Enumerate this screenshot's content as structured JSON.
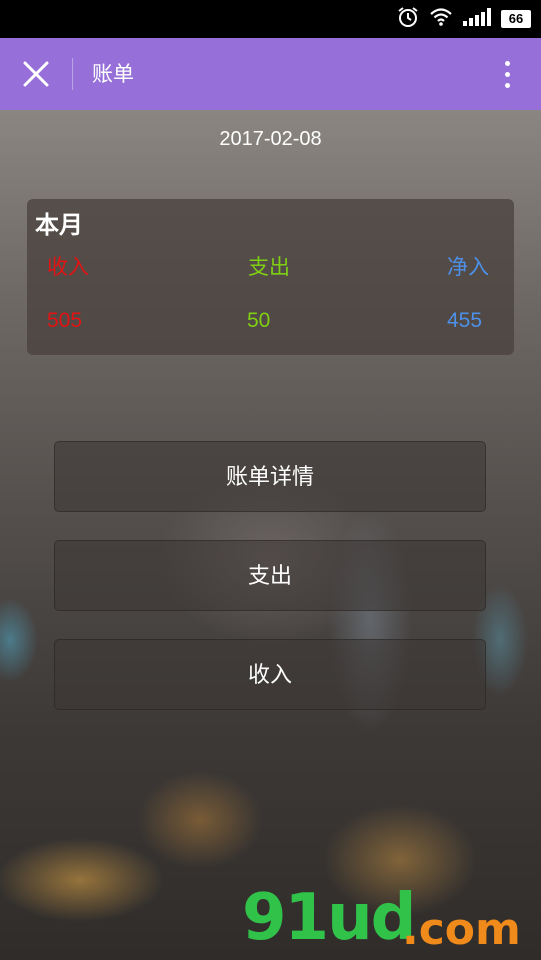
{
  "status_bar": {
    "battery": "66"
  },
  "app_bar": {
    "title": "账单"
  },
  "date": "2017-02-08",
  "summary": {
    "title": "本月",
    "income_label": "收入",
    "expense_label": "支出",
    "net_label": "净入",
    "income_value": "505",
    "expense_value": "50",
    "net_value": "455",
    "colors": {
      "income": "#e11414",
      "expense": "#7fd014",
      "net": "#4d90e8"
    }
  },
  "buttons": {
    "detail": "账单详情",
    "expense": "支出",
    "income": "收入"
  },
  "watermark": {
    "main": "91ud",
    "sub": ".com"
  },
  "theme": {
    "app_bar": "#9670d8"
  }
}
